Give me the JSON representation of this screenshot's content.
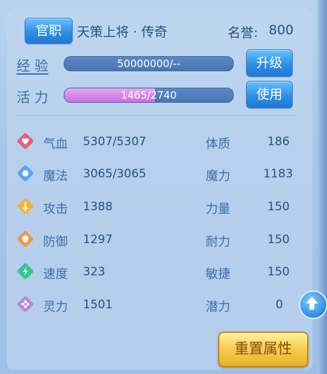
{
  "header": {
    "rank_button": "官职",
    "title": "天策上将 · 传奇",
    "fame_label": "名誉:",
    "fame_value": "800"
  },
  "exp": {
    "label": "经 验",
    "text": "50000000/--",
    "fill": 0,
    "button": "升级"
  },
  "vitality": {
    "label": "活 力",
    "text": "1465/2740",
    "fill": 0.535,
    "button": "使用"
  },
  "stats_left": [
    {
      "label": "气血",
      "value": "5307/5307",
      "icon": "heart-icon"
    },
    {
      "label": "魔法",
      "value": "3065/3065",
      "icon": "magic-icon"
    },
    {
      "label": "攻击",
      "value": "1388",
      "icon": "sword-icon"
    },
    {
      "label": "防御",
      "value": "1297",
      "icon": "shield-icon"
    },
    {
      "label": "速度",
      "value": "323",
      "icon": "lightning-icon"
    },
    {
      "label": "灵力",
      "value": "1501",
      "icon": "spirit-icon"
    }
  ],
  "stats_right": [
    {
      "label": "体质",
      "value": "186"
    },
    {
      "label": "魔力",
      "value": "1183"
    },
    {
      "label": "力量",
      "value": "150"
    },
    {
      "label": "耐力",
      "value": "150"
    },
    {
      "label": "敏捷",
      "value": "150"
    },
    {
      "label": "潜力",
      "value": "0"
    }
  ],
  "reset_button": "重置属性",
  "colors": {
    "heart": "#e8607a",
    "magic": "#5aa6ea",
    "attack": "#f2b43a",
    "defense": "#f1974a",
    "speed": "#35c792",
    "spirit": "#b78ad8"
  }
}
